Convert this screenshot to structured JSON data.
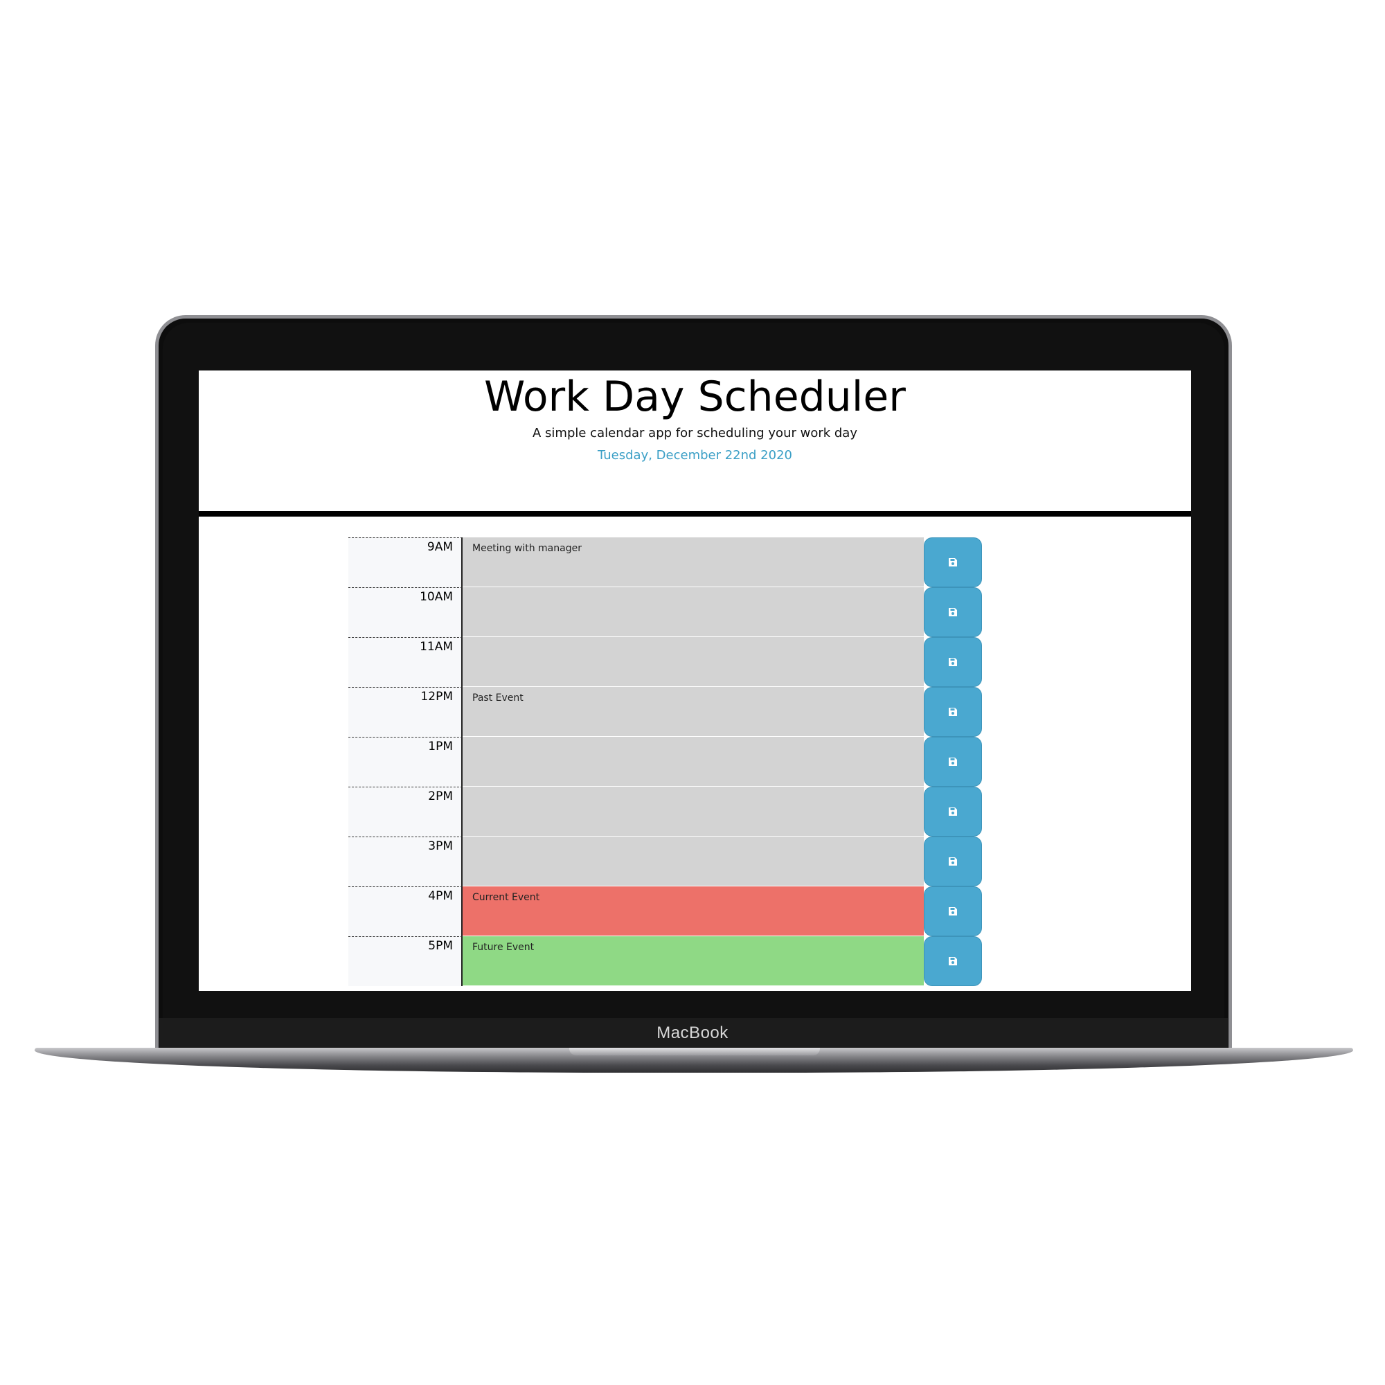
{
  "device": {
    "brand_label": "MacBook"
  },
  "header": {
    "title": "Work Day Scheduler",
    "lead": "A simple calendar app for scheduling your work day",
    "current_date": "Tuesday, December 22nd 2020"
  },
  "schedule": {
    "rows": [
      {
        "hour": "9AM",
        "text": "Meeting with manager",
        "state": "past",
        "save_icon": "save-icon"
      },
      {
        "hour": "10AM",
        "text": "",
        "state": "past",
        "save_icon": "save-icon"
      },
      {
        "hour": "11AM",
        "text": "",
        "state": "past",
        "save_icon": "save-icon"
      },
      {
        "hour": "12PM",
        "text": "Past Event",
        "state": "past",
        "save_icon": "save-icon"
      },
      {
        "hour": "1PM",
        "text": "",
        "state": "past",
        "save_icon": "save-icon"
      },
      {
        "hour": "2PM",
        "text": "",
        "state": "past",
        "save_icon": "save-icon"
      },
      {
        "hour": "3PM",
        "text": "",
        "state": "past",
        "save_icon": "save-icon"
      },
      {
        "hour": "4PM",
        "text": "Current Event",
        "state": "present",
        "save_icon": "save-icon"
      },
      {
        "hour": "5PM",
        "text": "Future Event",
        "state": "future",
        "save_icon": "save-icon"
      }
    ]
  },
  "colors": {
    "past": "#d3d3d3",
    "present": "#ed7169",
    "future": "#8fd985",
    "save_button": "#4aa8d0",
    "date_text": "#3b9fc6"
  }
}
